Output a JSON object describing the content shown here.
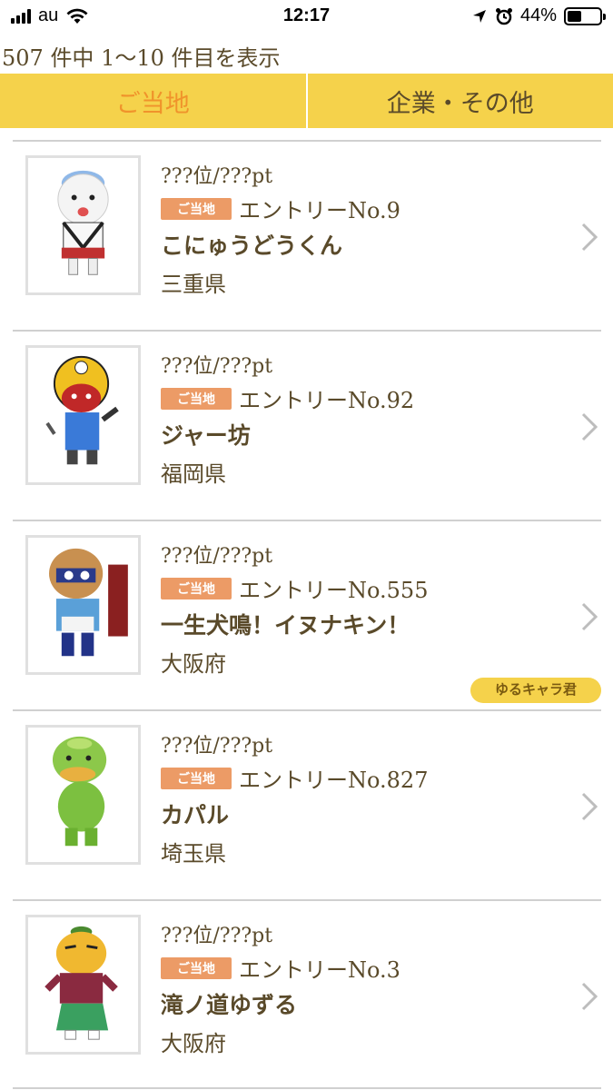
{
  "status_bar": {
    "carrier": "au",
    "time": "12:17",
    "battery_percent": "44%",
    "battery_level": 0.44,
    "icons": [
      "signal-icon",
      "wifi-icon",
      "location-icon",
      "alarm-icon",
      "battery-icon"
    ]
  },
  "result_count": "507 件中 1〜10 件目を表示",
  "tabs": [
    {
      "label": "ご当地",
      "active": true
    },
    {
      "label": "企業・その他",
      "active": false
    }
  ],
  "colors": {
    "tab_bar": "#f5d24b",
    "active_tab_text": "#f0932b",
    "badge": "#ec9b66",
    "text": "#5a4a2a"
  },
  "items": [
    {
      "rank": "???位/???pt",
      "badge": "ご当地",
      "entry": "エントリーNo.9",
      "name": "こにゅうどうくん",
      "prefecture": "三重県",
      "award": ""
    },
    {
      "rank": "???位/???pt",
      "badge": "ご当地",
      "entry": "エントリーNo.92",
      "name": "ジャー坊",
      "prefecture": "福岡県",
      "award": ""
    },
    {
      "rank": "???位/???pt",
      "badge": "ご当地",
      "entry": "エントリーNo.555",
      "name": "一生犬鳴！イヌナキン！",
      "prefecture": "大阪府",
      "award": "ゆるキャラ君"
    },
    {
      "rank": "???位/???pt",
      "badge": "ご当地",
      "entry": "エントリーNo.827",
      "name": "カパル",
      "prefecture": "埼玉県",
      "award": ""
    },
    {
      "rank": "???位/???pt",
      "badge": "ご当地",
      "entry": "エントリーNo.3",
      "name": "滝ノ道ゆずる",
      "prefecture": "大阪府",
      "award": ""
    }
  ]
}
